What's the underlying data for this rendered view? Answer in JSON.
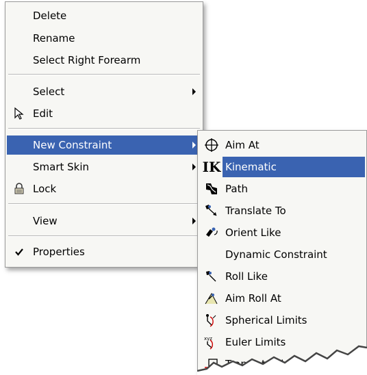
{
  "main_menu": {
    "items": [
      {
        "label": "Delete"
      },
      {
        "label": "Rename"
      },
      {
        "label": "Select Right Forearm"
      },
      {
        "label": "Select"
      },
      {
        "label": "Edit"
      },
      {
        "label": "New Constraint"
      },
      {
        "label": "Smart Skin"
      },
      {
        "label": "Lock"
      },
      {
        "label": "View"
      },
      {
        "label": "Properties"
      }
    ]
  },
  "sub_menu": {
    "items": [
      {
        "label": "Aim At",
        "icon": "aim-at-icon"
      },
      {
        "label": "Kinematic",
        "icon": "ik-icon"
      },
      {
        "label": "Path",
        "icon": "path-icon"
      },
      {
        "label": "Translate To",
        "icon": "translate-to-icon"
      },
      {
        "label": "Orient Like",
        "icon": "orient-like-icon"
      },
      {
        "label": "Dynamic Constraint",
        "icon": ""
      },
      {
        "label": "Roll Like",
        "icon": "roll-like-icon"
      },
      {
        "label": "Aim Roll At",
        "icon": "aim-roll-at-icon"
      },
      {
        "label": "Spherical Limits",
        "icon": "spherical-limits-icon"
      },
      {
        "label": "Euler Limits",
        "icon": "euler-limits-icon"
      },
      {
        "label": "Translate Limits",
        "icon": "translate-limits-icon"
      }
    ],
    "ik_icon_text": "IK"
  },
  "colors": {
    "highlight": "#3a63b1",
    "menu_bg": "#f7f7f4"
  }
}
